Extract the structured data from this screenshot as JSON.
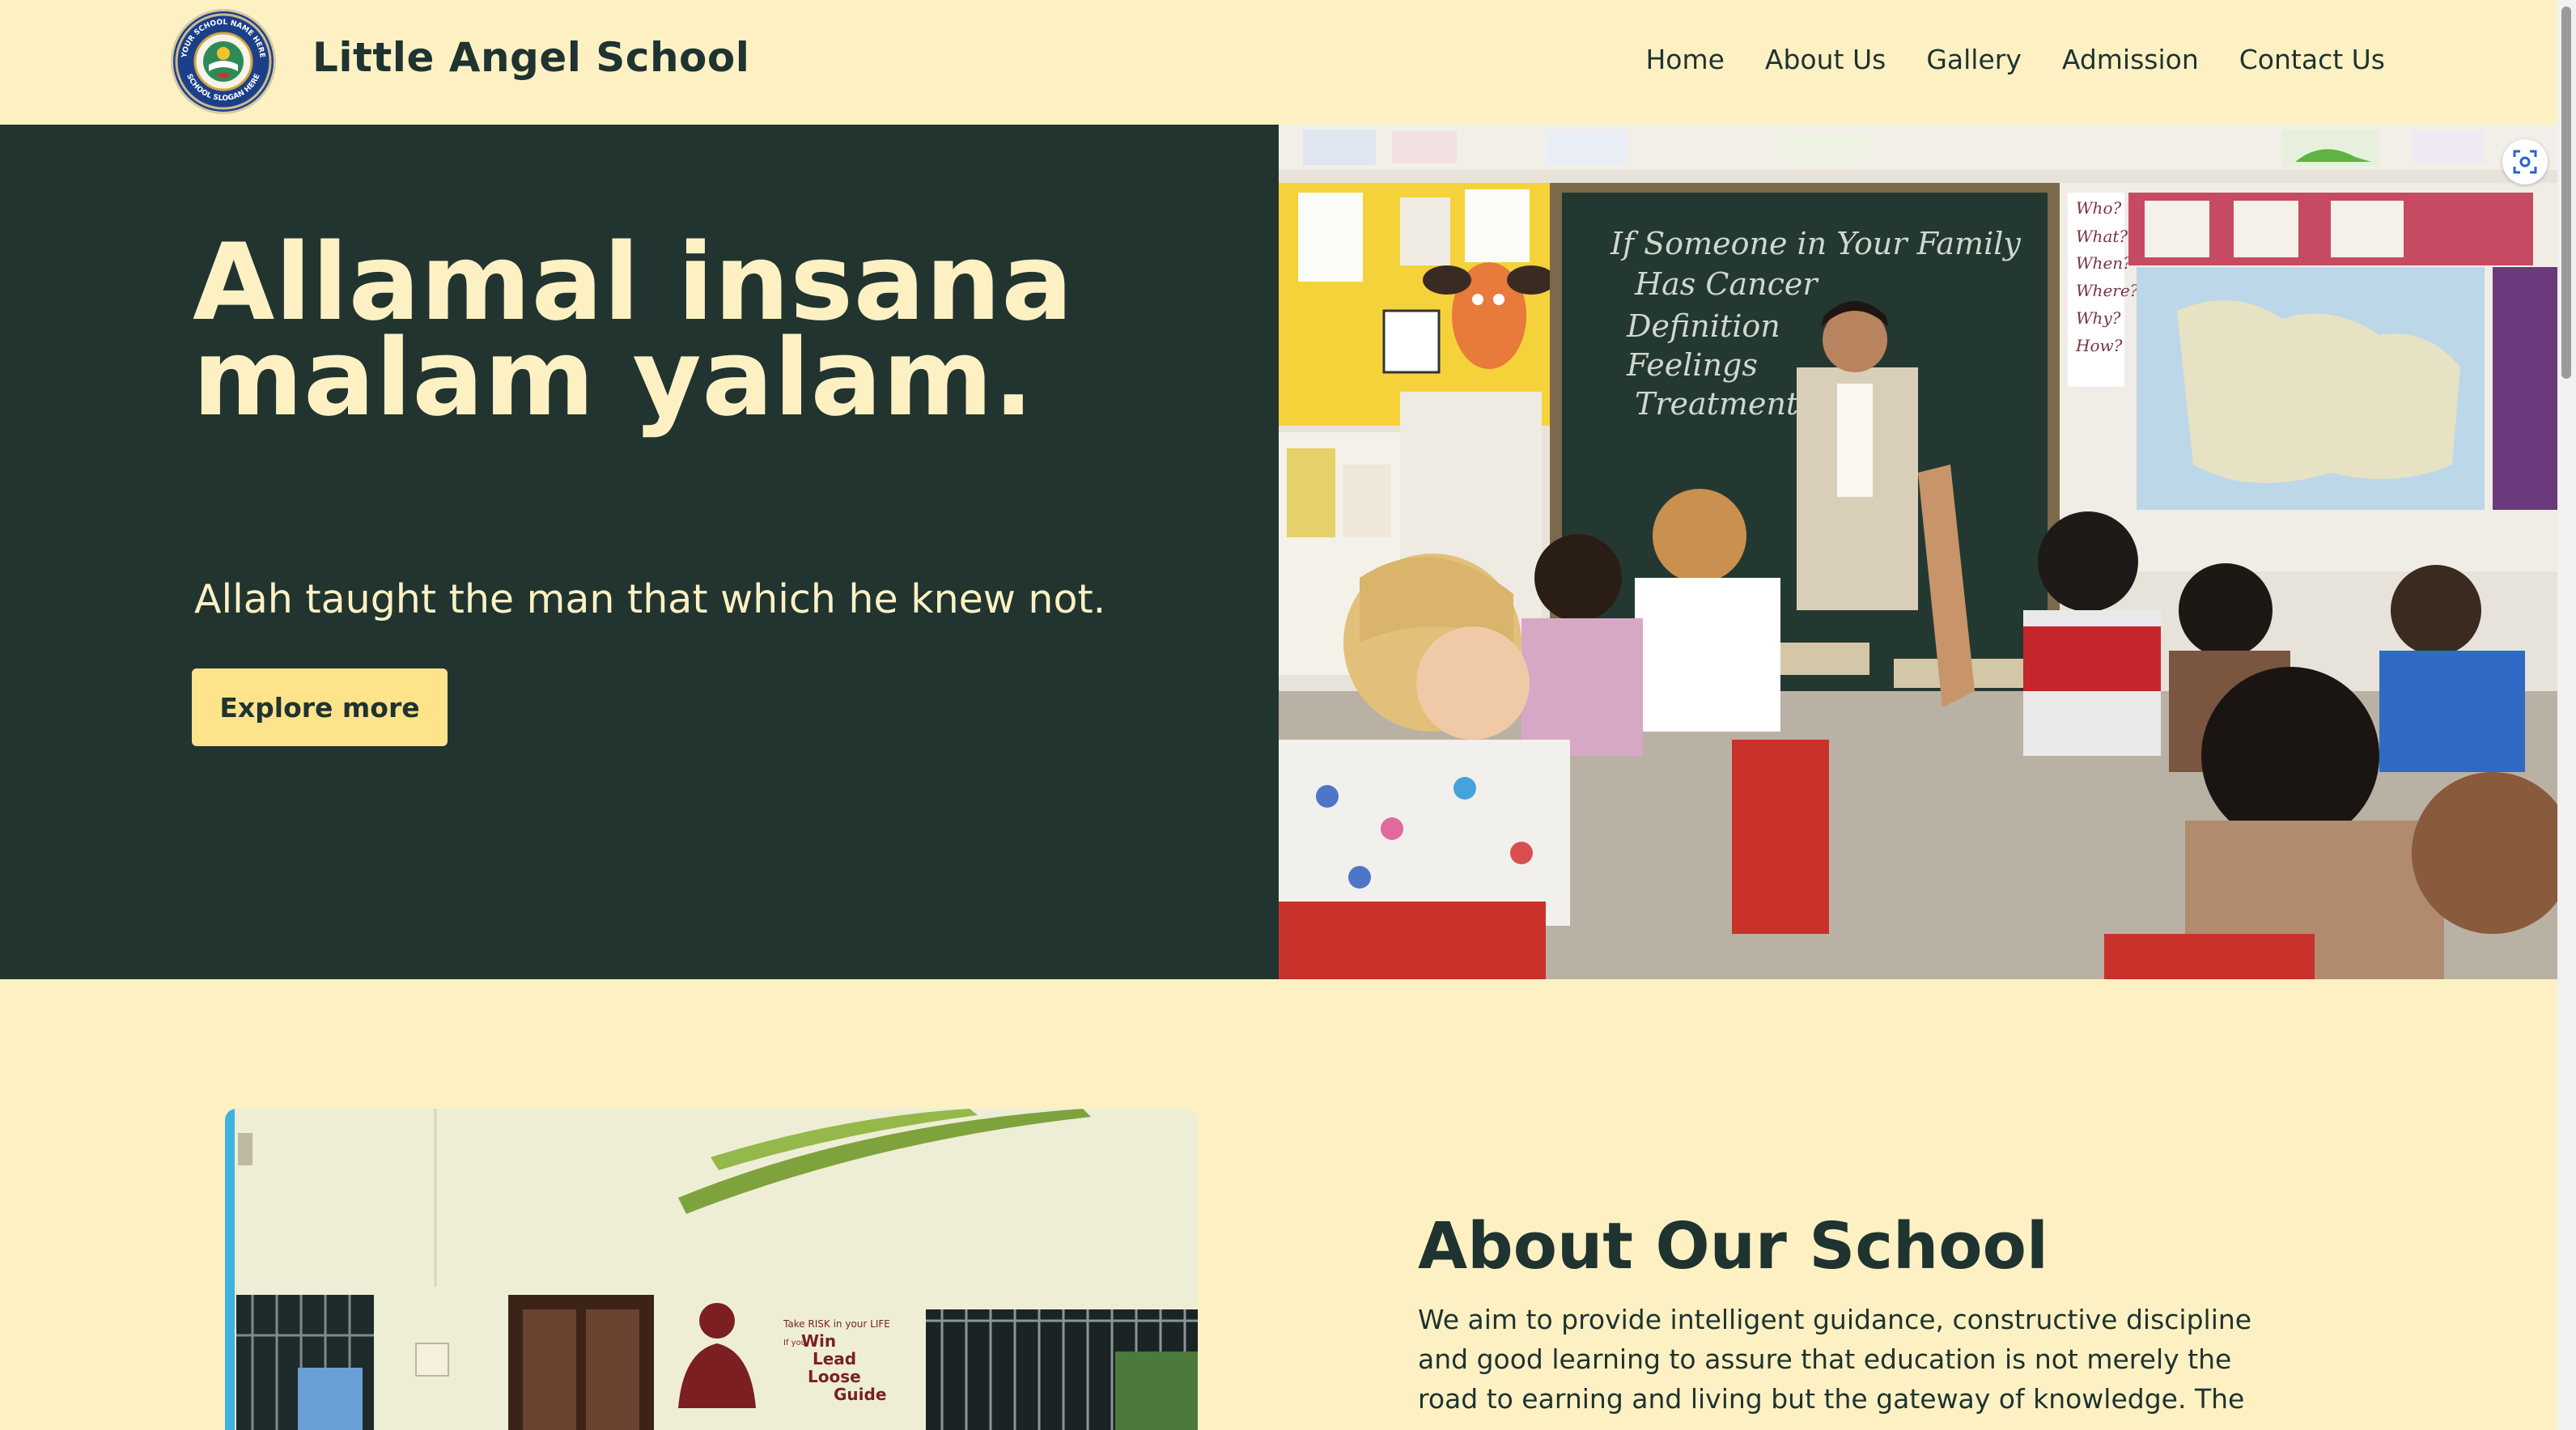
{
  "header": {
    "logo": {
      "ring_top": "YOUR SCHOOL NAME HERE",
      "ring_bottom": "SCHOOL SLOGAN HERE"
    },
    "brand": "Little Angel School",
    "nav": [
      {
        "label": "Home"
      },
      {
        "label": "About Us"
      },
      {
        "label": "Gallery"
      },
      {
        "label": "Admission"
      },
      {
        "label": "Contact Us"
      }
    ]
  },
  "hero": {
    "title_line1": "Allamal insana",
    "title_line2": "malam yalam.",
    "subtitle": "Allah taught the man that which he knew not.",
    "cta_label": "Explore more",
    "image": {
      "chalkboard_lines": [
        "If Someone in Your Family",
        "Has Cancer",
        "Definition",
        "Feelings",
        "Treatment"
      ],
      "question_words": [
        "Who?",
        "What?",
        "When?",
        "Where?",
        "Why?",
        "How?"
      ]
    }
  },
  "about": {
    "title": "About Our School",
    "text": "We aim to provide intelligent guidance, constructive discipline and good learning to assure that education is not merely the road to earning and living but the gateway of knowledge. The",
    "image": {
      "wall_lines": [
        "Take RISK in your LIFE",
        "If you",
        "Win",
        "Lead",
        "Loose",
        "Guide"
      ]
    }
  },
  "colors": {
    "background": "#fdf1c4",
    "hero_dark": "#213430",
    "accent": "#fde38a",
    "text_dark": "#1f3330"
  },
  "icons": {
    "lens": "image-search-icon"
  }
}
